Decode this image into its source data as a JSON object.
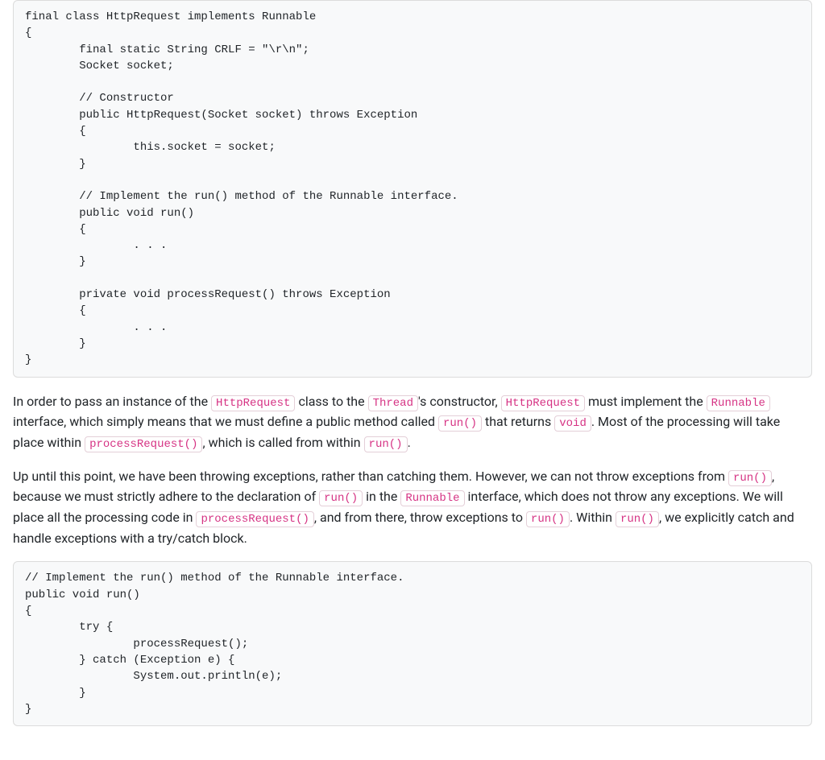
{
  "codeblocks": {
    "block1": "final class HttpRequest implements Runnable\n{\n        final static String CRLF = \"\\r\\n\";\n        Socket socket;\n\n        // Constructor\n        public HttpRequest(Socket socket) throws Exception\n        {\n                this.socket = socket;\n        }\n\n        // Implement the run() method of the Runnable interface.\n        public void run()\n        {\n                . . .\n        }\n\n        private void processRequest() throws Exception\n        {\n                . . .\n        }\n}",
    "block2": "// Implement the run() method of the Runnable interface.\npublic void run()\n{\n        try {\n                processRequest();\n        } catch (Exception e) {\n                System.out.println(e);\n        }\n}"
  },
  "paragraphs": {
    "p1": {
      "t0": "In order to pass an instance of the ",
      "c0": "HttpRequest",
      "t1": " class to the ",
      "c1": "Thread",
      "t2": "'s constructor, ",
      "c2": "HttpRequest",
      "t3": " must implement the ",
      "c3": "Runnable",
      "t4": " interface, which simply means that we must define a public method called ",
      "c4": "run()",
      "t5": " that returns ",
      "c5": "void",
      "t6": ". Most of the processing will take place within ",
      "c6": "processRequest()",
      "t7": ", which is called from within ",
      "c7": "run()",
      "t8": "."
    },
    "p2": {
      "t0": "Up until this point, we have been throwing exceptions, rather than catching them. However, we can not throw exceptions from ",
      "c0": "run()",
      "t1": ", because we must strictly adhere to the declaration of ",
      "c1": "run()",
      "t2": " in the ",
      "c2": "Runnable",
      "t3": " interface, which does not throw any exceptions. We will place all the processing code in ",
      "c3": "processRequest()",
      "t4": ", and from there, throw exceptions to ",
      "c4": "run()",
      "t5": ". Within ",
      "c5": "run()",
      "t6": ", we explicitly catch and handle exceptions with a try/catch block."
    }
  }
}
